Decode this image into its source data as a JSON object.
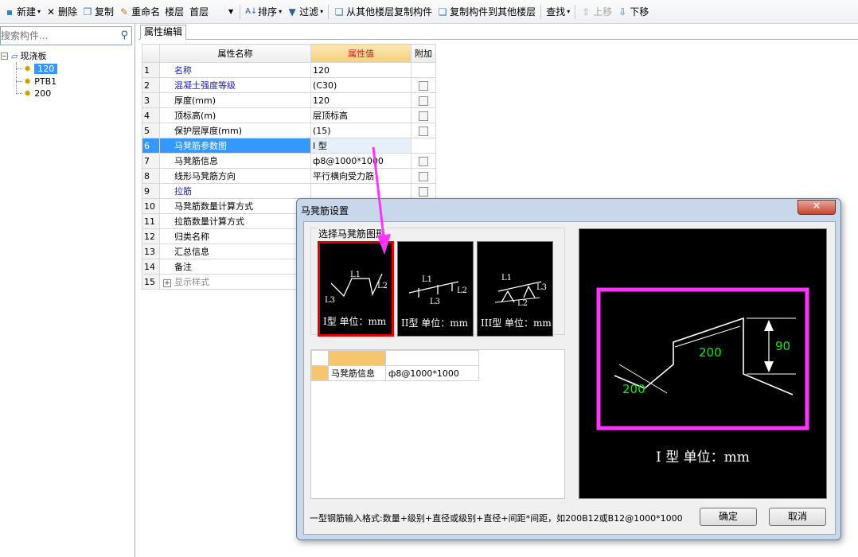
{
  "toolbar": {
    "new_label": "新建",
    "delete_label": "删除",
    "copy_label": "复制",
    "rename_label": "重命名",
    "floor_label": "楼层",
    "floor_value": "首层",
    "sort_label": "排序",
    "filter_label": "过滤",
    "copy_from_floor_label": "从其他楼层复制构件",
    "copy_to_floor_label": "复制构件到其他楼层",
    "find_label": "查找",
    "move_up_label": "上移",
    "move_down_label": "下移"
  },
  "sidebar": {
    "search_placeholder": "搜索构件...",
    "root_label": "现浇板",
    "items": [
      {
        "label": "120"
      },
      {
        "label": "PTB1"
      },
      {
        "label": "200"
      }
    ]
  },
  "tabs": {
    "property_editor": "属性编辑"
  },
  "property_grid": {
    "headers": {
      "name": "属性名称",
      "value": "属性值",
      "extra": "附加"
    },
    "rows": [
      {
        "num": "1",
        "name": "名称",
        "value": "120"
      },
      {
        "num": "2",
        "name": "混凝土强度等级",
        "value": "(C30)"
      },
      {
        "num": "3",
        "name": "厚度(mm)",
        "value": "120"
      },
      {
        "num": "4",
        "name": "顶标高(m)",
        "value": "层顶标高"
      },
      {
        "num": "5",
        "name": "保护层厚度(mm)",
        "value": "(15)"
      },
      {
        "num": "6",
        "name": "马凳筋参数图",
        "value": "I 型"
      },
      {
        "num": "7",
        "name": "马凳筋信息",
        "value": "ф8@1000*1000"
      },
      {
        "num": "8",
        "name": "线形马凳筋方向",
        "value": "平行横向受力筋"
      },
      {
        "num": "9",
        "name": "拉筋",
        "value": ""
      },
      {
        "num": "10",
        "name": "马凳筋数量计算方式",
        "value": ""
      },
      {
        "num": "11",
        "name": "拉筋数量计算方式",
        "value": ""
      },
      {
        "num": "12",
        "name": "归类名称",
        "value": ""
      },
      {
        "num": "13",
        "name": "汇总信息",
        "value": ""
      },
      {
        "num": "14",
        "name": "备注",
        "value": ""
      },
      {
        "num": "15",
        "name": "显示样式",
        "value": ""
      }
    ]
  },
  "dialog": {
    "title": "马凳筋设置",
    "group_label": "选择马凳筋图形",
    "thumbnails": [
      {
        "caption": "I型 单位：mm"
      },
      {
        "caption": "II型 单位：mm"
      },
      {
        "caption": "III型 单位：mm"
      }
    ],
    "info_table": {
      "row_label": "马凳筋信息",
      "row_value": "ф8@1000*1000"
    },
    "preview": {
      "caption": "I 型  单位：mm",
      "dim_height": "90",
      "dim_top": "200",
      "dim_left": "200",
      "highlight_color": "#ff33ff"
    },
    "hint": "一型钢筋输入格式:数量+级别+直径或级别+直径+间距*间距，如200B12或B12@1000*1000",
    "ok_label": "确定",
    "cancel_label": "取消"
  },
  "thumb_labels": {
    "L1": "L1",
    "L2": "L2",
    "L3": "L3"
  },
  "colors": {
    "accent": "#3399ff",
    "selection_frame": "#e00000",
    "arrow": "#ff33ff"
  }
}
